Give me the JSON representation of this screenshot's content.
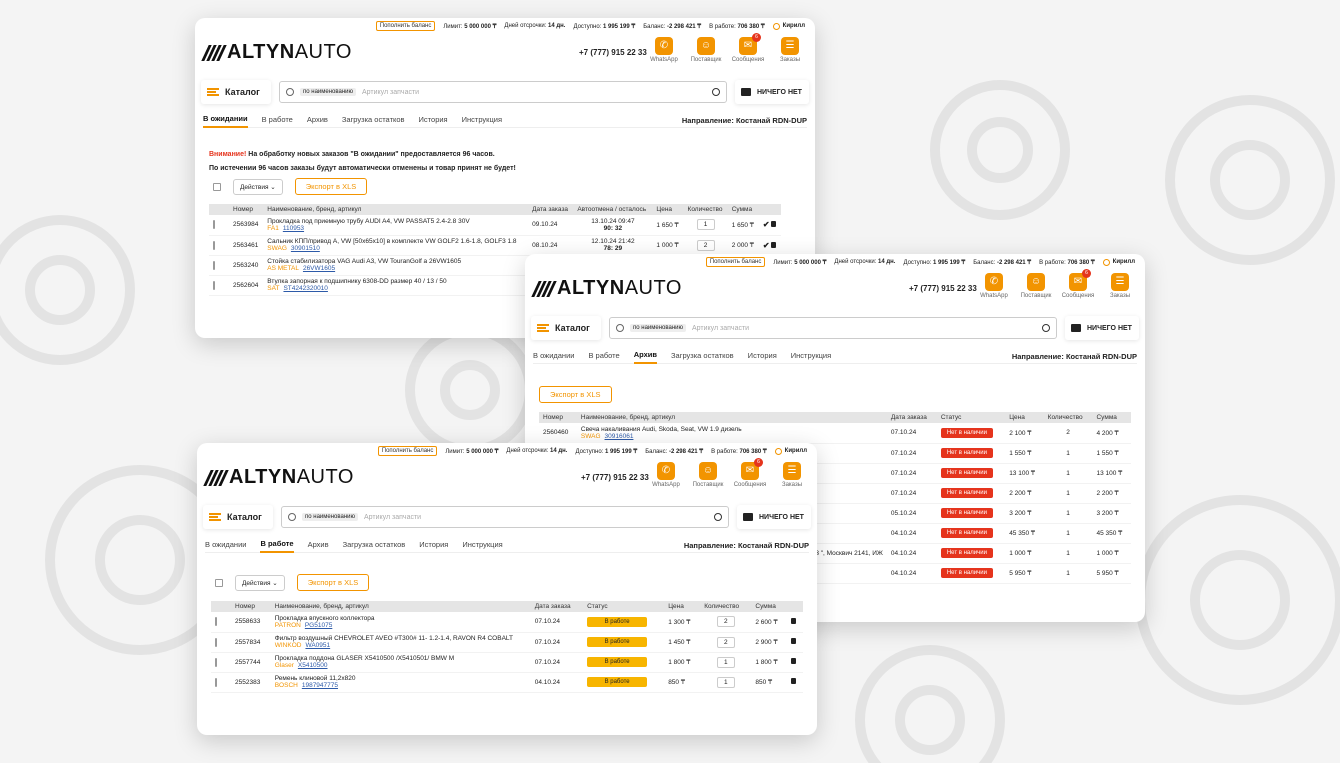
{
  "header": {
    "topup": "Пополнить баланс",
    "limit_label": "Лимит:",
    "limit_value": "5 000 000 ₸",
    "delay_label": "Дней отсрочки:",
    "delay_value": "14 дн.",
    "available_label": "Доступно:",
    "available_value": "1 995 199 ₸",
    "balance_label": "Баланс:",
    "balance_value": "-2 298 421 ₸",
    "inwork_label": "В работе:",
    "inwork_value": "706 380 ₸",
    "user": "Кирилл",
    "logo_altyn": "ALTYN",
    "logo_auto": "AUTO",
    "phone": "+7 (777) 915 22 33",
    "icons": [
      {
        "label": "WhatsApp",
        "icon": "whatsapp-icon",
        "badge": ""
      },
      {
        "label": "Поставщик",
        "icon": "supplier-icon",
        "badge": ""
      },
      {
        "label": "Сообщения",
        "icon": "messages-icon",
        "badge": "6"
      },
      {
        "label": "Заказы",
        "icon": "orders-icon",
        "badge": ""
      }
    ],
    "catalog": "Каталог",
    "search_chip": "по наименованию",
    "search_placeholder": "Артикул запчасти",
    "cart": "НИЧЕГО НЕТ"
  },
  "tabs": [
    "В ожидании",
    "В работе",
    "Архив",
    "Загрузка остатков",
    "История",
    "Инструкция"
  ],
  "direction": "Направление: Костанай RDN-DUP",
  "accent_color": "#f29400",
  "window1": {
    "warning_attn": "Внимание!",
    "warning_line1": " На обработку новых заказов \"В ожидании\" предоставляется 96 часов.",
    "warning_line2": "По истечении 96 часов заказы будут автоматически отменены и товар принят не будет!",
    "actions": "Действия",
    "export": "Экспорт в XLS",
    "columns": [
      "Номер",
      "Наименование, бренд, артикул",
      "Дата заказа",
      "Автоотмена / осталось",
      "Цена",
      "Количество",
      "Сумма"
    ],
    "rows": [
      {
        "num": "2563984",
        "name": "Прокладка под приемную трубу AUDI A4, VW PASSAT5 2.4-2.8 30V",
        "brand": "FA1",
        "art": "110953",
        "date": "09.10.24",
        "auto1": "13.10.24 09:47",
        "auto2": "90: 32",
        "price": "1 650 ₸",
        "qty": "1",
        "sum": "1 650 ₸"
      },
      {
        "num": "2563461",
        "name": "Сальник КПП/привод A, VW [50x65x10] в комплекте VW GOLF2 1.6-1.8, GOLF3 1.8",
        "brand": "SWAG",
        "art": "30901510",
        "date": "08.10.24",
        "auto1": "12.10.24 21:42",
        "auto2": "78: 29",
        "price": "1 000 ₸",
        "qty": "2",
        "sum": "2 000 ₸"
      },
      {
        "num": "2563240",
        "name": "Стойка стабилизатора VAG Audi A3, VW TouranGolf а 26VW1605",
        "brand": "AS METAL",
        "art": "26VW1605",
        "date": "",
        "auto1": "",
        "auto2": "",
        "price": "",
        "qty": "",
        "sum": ""
      },
      {
        "num": "2562604",
        "name": "Втулка запорная к подшипнику 6308-DD размер 40 / 13 / 50",
        "brand": "SAT",
        "art": "ST4242320010",
        "date": "",
        "auto1": "",
        "auto2": "",
        "price": "",
        "qty": "",
        "sum": ""
      }
    ]
  },
  "window2": {
    "export": "Экспорт в XLS",
    "columns": [
      "Номер",
      "Наименование, бренд, артикул",
      "Дата заказа",
      "Статус",
      "Цена",
      "Количество",
      "Сумма"
    ],
    "rows": [
      {
        "num": "2560460",
        "name": "Свеча накаливания Audi, Skoda, Seat, VW 1.9 дизель",
        "brand": "SWAG",
        "art": "30916061",
        "date": "07.10.24",
        "status": "Нет в наличии",
        "price": "2 100 ₸",
        "qty": "2",
        "sum": "4 200 ₸"
      },
      {
        "num": "",
        "name": "",
        "brand": "",
        "art": "",
        "date": "07.10.24",
        "status": "Нет в наличии",
        "price": "1 550 ₸",
        "qty": "1",
        "sum": "1 550 ₸"
      },
      {
        "num": "",
        "name": "",
        "brand": "",
        "art": "",
        "date": "07.10.24",
        "status": "Нет в наличии",
        "price": "13 100 ₸",
        "qty": "1",
        "sum": "13 100 ₸"
      },
      {
        "num": "",
        "name": "",
        "brand": "",
        "art": "",
        "date": "07.10.24",
        "status": "Нет в наличии",
        "price": "2 200 ₸",
        "qty": "1",
        "sum": "2 200 ₸"
      },
      {
        "num": "",
        "name": "",
        "brand": "",
        "art": "",
        "date": "05.10.24",
        "status": "Нет в наличии",
        "price": "3 200 ₸",
        "qty": "1",
        "sum": "3 200 ₸"
      },
      {
        "num": "",
        "name": "",
        "brand": "",
        "art": "",
        "date": "04.10.24",
        "status": "Нет в наличии",
        "price": "45 350 ₸",
        "qty": "1",
        "sum": "45 350 ₸"
      },
      {
        "num": "",
        "name": "17,2131, 21312, 2123 \", Москвич 2141, ИЖ",
        "brand": "",
        "art": "",
        "date": "04.10.24",
        "status": "Нет в наличии",
        "price": "1 000 ₸",
        "qty": "1",
        "sum": "1 000 ₸"
      },
      {
        "num": "",
        "name": "",
        "brand": "",
        "art": "",
        "date": "04.10.24",
        "status": "Нет в наличии",
        "price": "5 950 ₸",
        "qty": "1",
        "sum": "5 950 ₸"
      }
    ]
  },
  "window3": {
    "actions": "Действия",
    "export": "Экспорт в XLS",
    "columns": [
      "Номер",
      "Наименование, бренд, артикул",
      "Дата заказа",
      "Статус",
      "Цена",
      "Количество",
      "Сумма"
    ],
    "rows": [
      {
        "num": "2558633",
        "name": "Прокладка впускного коллектора",
        "brand": "PATRON",
        "art": "PG51075",
        "date": "07.10.24",
        "status": "В работе",
        "price": "1 300 ₸",
        "qty": "2",
        "sum": "2 600 ₸"
      },
      {
        "num": "2557834",
        "name": "Фильтр воздушный CHEVROLET AVEO #T300# 11- 1.2-1.4, RAVON R4 COBALT",
        "brand": "WINKOD",
        "art": "WA0951",
        "date": "07.10.24",
        "status": "В работе",
        "price": "1 450 ₸",
        "qty": "2",
        "sum": "2 900 ₸"
      },
      {
        "num": "2557744",
        "name": "Прокладка поддона GLASER X5410500 /X5410501/ BMW M",
        "brand": "Glaser",
        "art": "X5410500",
        "date": "07.10.24",
        "status": "В работе",
        "price": "1 800 ₸",
        "qty": "1",
        "sum": "1 800 ₸"
      },
      {
        "num": "2552383",
        "name": "Ремень клиновой 11,2x820",
        "brand": "BOSCH",
        "art": "1987947775",
        "date": "04.10.24",
        "status": "В работе",
        "price": "850 ₸",
        "qty": "1",
        "sum": "850 ₸"
      }
    ]
  }
}
